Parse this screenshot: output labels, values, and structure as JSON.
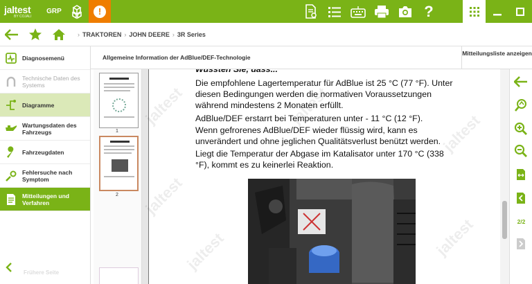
{
  "app": {
    "logo_main": "jaltest",
    "logo_sub": "BY COJALI",
    "group_label": "GRP"
  },
  "breadcrumb": [
    "TRAKTOREN",
    "JOHN DEERE",
    "3R Series"
  ],
  "sidebar": {
    "items": [
      {
        "label": "Diagnosemenü",
        "state": "normal",
        "icon": "diagnosis-icon"
      },
      {
        "label": "Technische Daten des Systems",
        "state": "disabled",
        "icon": "horseshoe-icon"
      },
      {
        "label": "Diagramme",
        "state": "active",
        "icon": "diagram-icon"
      },
      {
        "label": "Wartungsdaten des Fahrzeugs",
        "state": "normal",
        "icon": "oil-can-icon"
      },
      {
        "label": "Fahrzeugdaten",
        "state": "normal",
        "icon": "wrench-icon"
      },
      {
        "label": "Fehlersuche nach Symptom",
        "state": "normal",
        "icon": "wrench-gear-icon"
      },
      {
        "label": "Mitteilungen und Verfahren",
        "state": "selected",
        "icon": "document-icon"
      }
    ],
    "ghost_text": "Frühere Seite"
  },
  "content": {
    "title": "Allgemeine Information der AdBlue/DEF-Technologie",
    "list_button": "Mitteilungsliste anzeigen"
  },
  "thumbnails": [
    {
      "number": "1"
    },
    {
      "number": "2"
    }
  ],
  "document": {
    "heading_partial": "Wussten Sie, dass...",
    "paragraphs": [
      [
        "Die empfohlene Lagertemperatur für AdBlue ist 25 °C (77 °F). Unter",
        "diesen Bedingungen werden die normativen Voraussetzungen",
        "während mindestens 2 Monaten erfüllt."
      ],
      [
        "AdBlue/DEF erstarrt bei Temperaturen unter - 11 °C (12 °F)."
      ],
      [
        "Wenn gefrorenes AdBlue/DEF wieder flüssig wird, kann es",
        "unverändert und ohne jeglichen Qualitätsverlust benützt werden."
      ],
      [
        "Liegt die Temperatur der Abgase im Katalisator unter 170 °C (338",
        "°F), kommt es zu keinerlei Reaktion."
      ]
    ],
    "watermark_text": "jaltest"
  },
  "page_indicator": "2/2",
  "colors": {
    "brand_green": "#7ab317",
    "alert_orange": "#ef7d00"
  }
}
